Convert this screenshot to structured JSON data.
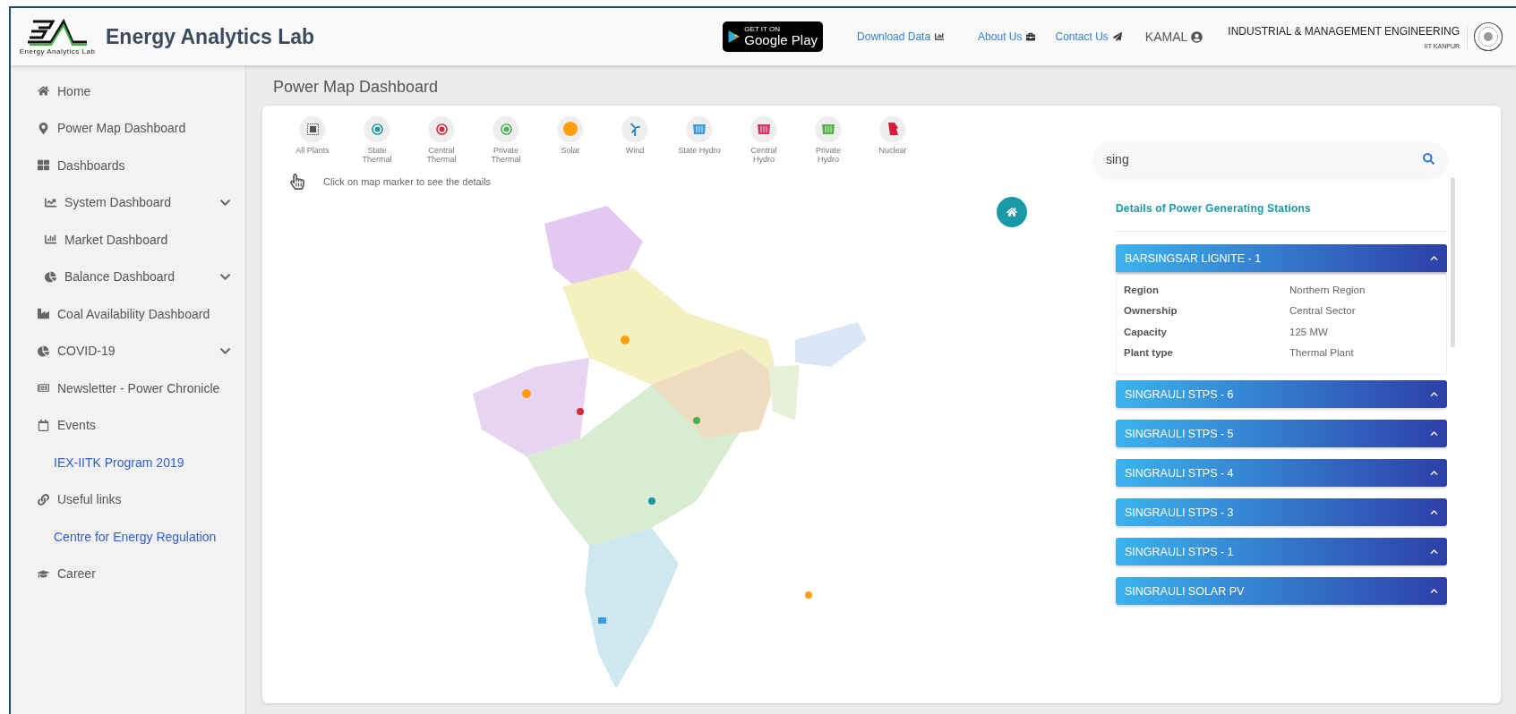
{
  "header": {
    "brand": "Energy Analytics Lab",
    "logo_caption": "Energy Analytics Lab",
    "store_badge": {
      "small": "GET IT ON",
      "large": "Google Play"
    },
    "links": [
      {
        "label": "Download Data",
        "kind": "download"
      },
      {
        "label": "About Us",
        "kind": "about"
      },
      {
        "label": "Contact Us",
        "kind": "contact"
      }
    ],
    "user": "KAMAL",
    "institute": {
      "name": "INDUSTRIAL & MANAGEMENT ENGINEERING",
      "place": "IIT KANPUR"
    }
  },
  "sidebar": {
    "items": [
      {
        "label": "Home",
        "kind": "item",
        "collapsible": false
      },
      {
        "label": "Power Map Dashboard",
        "kind": "item",
        "collapsible": false
      },
      {
        "label": "Dashboards",
        "kind": "item",
        "collapsible": false,
        "children": [
          {
            "label": "System Dashboard",
            "kind": "item",
            "collapsible": true
          },
          {
            "label": "Market Dashboard",
            "kind": "item",
            "collapsible": false
          },
          {
            "label": "Balance Dashboard",
            "kind": "item",
            "collapsible": true
          }
        ]
      },
      {
        "label": "Coal Availability Dashboard",
        "kind": "item",
        "collapsible": false
      },
      {
        "label": "COVID-19",
        "kind": "item",
        "collapsible": true
      },
      {
        "label": "Newsletter - Power Chronicle",
        "kind": "item",
        "collapsible": false
      },
      {
        "label": "Events",
        "kind": "item",
        "collapsible": false,
        "children": [
          {
            "label": "IEX-IITK Program 2019",
            "kind": "link",
            "collapsible": false
          }
        ]
      },
      {
        "label": "Useful links",
        "kind": "item",
        "collapsible": false,
        "children": [
          {
            "label": "Centre for Energy Regulation",
            "kind": "link",
            "collapsible": false
          }
        ]
      },
      {
        "label": "Career",
        "kind": "item",
        "collapsible": false
      }
    ]
  },
  "page_title": "Power Map Dashboard",
  "legend": [
    {
      "label": "All Plants",
      "kind": "all",
      "color": "#555555"
    },
    {
      "label": "State Thermal",
      "kind": "thermal",
      "color": "#1a9aa0"
    },
    {
      "label": "Central Thermal",
      "kind": "thermal",
      "color": "#d62d3a"
    },
    {
      "label": "Private Thermal",
      "kind": "thermal",
      "color": "#4caf50"
    },
    {
      "label": "Solar",
      "kind": "solar",
      "color": "#ff9f0f"
    },
    {
      "label": "Wind",
      "kind": "wind",
      "color": "#2a7fb0"
    },
    {
      "label": "State Hydro",
      "kind": "hydro",
      "color": "#3d9be0"
    },
    {
      "label": "Central Hydro",
      "kind": "hydro",
      "color": "#d6336c"
    },
    {
      "label": "Private Hydro",
      "kind": "hydro",
      "color": "#55b04a"
    },
    {
      "label": "Nuclear",
      "kind": "nuclear",
      "color": "#d81b3c"
    }
  ],
  "hint": "Click on map marker to see the details",
  "search": {
    "value": "sing"
  },
  "details": {
    "title": "Details of Power Generating Stations",
    "stations": [
      {
        "name": "BARSINGSAR LIGNITE - 1",
        "expanded": true,
        "rows": [
          {
            "label": "Region",
            "value": "Northern Region"
          },
          {
            "label": "Ownership",
            "value": "Central Sector"
          },
          {
            "label": "Capacity",
            "value": "125 MW"
          },
          {
            "label": "Plant type",
            "value": "Thermal Plant"
          }
        ]
      },
      {
        "name": "SINGRAULI STPS - 6",
        "expanded": false
      },
      {
        "name": "SINGRAULI STPS - 5",
        "expanded": false
      },
      {
        "name": "SINGRAULI STPS - 4",
        "expanded": false
      },
      {
        "name": "SINGRAULI STPS - 3",
        "expanded": false
      },
      {
        "name": "SINGRAULI STPS - 1",
        "expanded": false
      },
      {
        "name": "SINGRAULI SOLAR PV",
        "expanded": false
      }
    ]
  }
}
